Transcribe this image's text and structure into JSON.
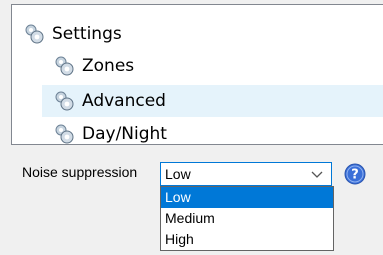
{
  "tree": {
    "items": [
      {
        "label": "Settings",
        "icon": "gear-cluster-icon"
      },
      {
        "label": "Zones",
        "icon": "gear-cluster-icon"
      },
      {
        "label": "Advanced",
        "icon": "gear-cluster-icon",
        "selected": true
      },
      {
        "label": "Day/Night",
        "icon": "gear-cluster-icon"
      }
    ]
  },
  "noise": {
    "label": "Noise suppression",
    "selected_value": "Low",
    "options": [
      "Low",
      "Medium",
      "High"
    ],
    "help_icon": "question-circle-icon"
  },
  "colors": {
    "accent": "#0078d7",
    "selected_row": "#e5f3fb",
    "help_blue": "#3a6fd8"
  }
}
